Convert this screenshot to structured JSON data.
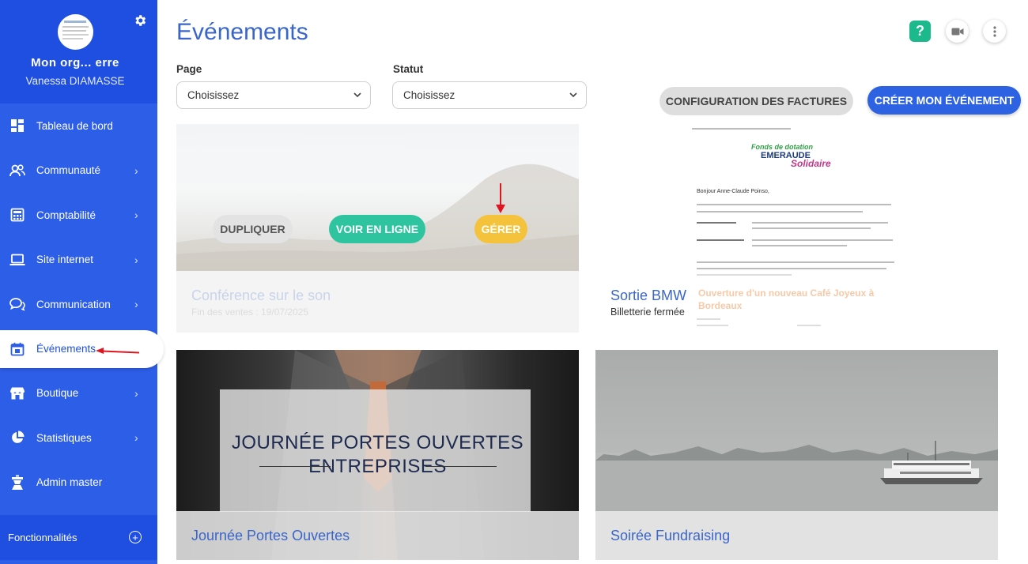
{
  "sidebar": {
    "org_name": "Mon org... erre",
    "user_name": "Vanessa DIAMASSE",
    "items": [
      {
        "label": "Tableau de bord",
        "icon": "dashboard-icon",
        "chevron": false
      },
      {
        "label": "Communauté",
        "icon": "community-icon",
        "chevron": true
      },
      {
        "label": "Comptabilité",
        "icon": "calculator-icon",
        "chevron": true
      },
      {
        "label": "Site internet",
        "icon": "laptop-icon",
        "chevron": true
      },
      {
        "label": "Communication",
        "icon": "chat-icon",
        "chevron": true
      },
      {
        "label": "Événements",
        "icon": "calendar-icon",
        "chevron": false,
        "active": true
      },
      {
        "label": "Boutique",
        "icon": "store-icon",
        "chevron": true
      },
      {
        "label": "Statistiques",
        "icon": "pie-chart-icon",
        "chevron": true
      },
      {
        "label": "Admin master",
        "icon": "admin-icon",
        "chevron": false
      }
    ],
    "footer_label": "Fonctionnalités"
  },
  "header": {
    "title": "Événements",
    "help_label": "?"
  },
  "filters": {
    "page_label": "Page",
    "page_value": "Choisissez",
    "status_label": "Statut",
    "status_value": "Choisissez"
  },
  "actions": {
    "config_label": "CONFIGURATION DES FACTURES",
    "create_label": "CRÉER MON ÉVÉNEMENT"
  },
  "cards": [
    {
      "title": "Conférence sur le son",
      "subtitle": "Fin des ventes : 19/07/2025",
      "buttons": {
        "duplicate": "DUPLIQUER",
        "view": "VOIR EN LIGNE",
        "manage": "GÉRER"
      }
    },
    {
      "title": "Sortie BMW",
      "subtitle": "Billetterie fermée",
      "doc": {
        "logo_line1": "Fonds de dotation",
        "logo_line2": "EMERAUDE",
        "logo_line3": "Solidaire",
        "greeting": "Bonjour Anne-Claude Poinso,",
        "ghost_title": "Ouverture d'un nouveau Café Joyeux à Bordeaux"
      }
    },
    {
      "title": "Journée Portes Ouvertes",
      "headline_line1": "JOURNÉE PORTES OUVERTES",
      "headline_line2": "ENTREPRISES"
    },
    {
      "title": "Soirée Fundraising"
    }
  ],
  "colors": {
    "sidebar": "#2d5ee8",
    "sidebar_dark": "#1f4fe0",
    "accent": "#3a66c9",
    "create": "#2d62e3",
    "voir": "#2ec4a0",
    "gerer": "#f4c23b",
    "help": "#1bb98b",
    "arrow": "#e0141e"
  }
}
